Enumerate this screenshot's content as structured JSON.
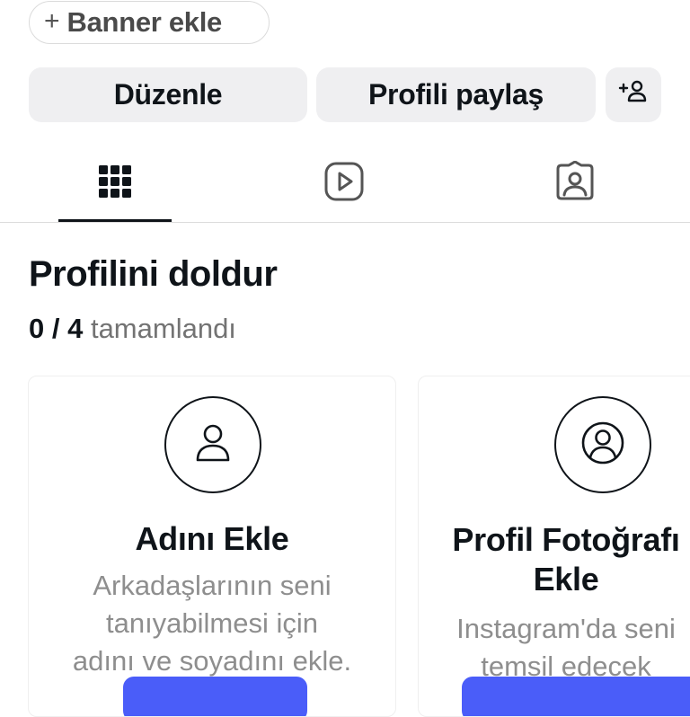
{
  "banner": {
    "plus": "+",
    "label": "Banner ekle"
  },
  "actions": {
    "edit_label": "Düzenle",
    "share_label": "Profili paylaş"
  },
  "tabs": [
    {
      "icon": "grid-icon",
      "active": true
    },
    {
      "icon": "reels-play-icon",
      "active": false
    },
    {
      "icon": "tagged-portrait-icon",
      "active": false
    }
  ],
  "profile_completion": {
    "title": "Profilini doldur",
    "count": "0 / 4",
    "status": "tamamlandı"
  },
  "cards": [
    {
      "icon": "user-icon",
      "title": "Adını Ekle",
      "description_lines": [
        "Arkadaşlarının seni",
        "tanıyabilmesi için",
        "adını ve soyadını ekle."
      ]
    },
    {
      "icon": "profile-photo-icon",
      "title_lines": [
        "Profil Fotoğrafı",
        "Ekle"
      ],
      "description_lines": [
        "Instagram'da seni",
        "temsil edecek"
      ]
    }
  ],
  "colors": {
    "accent": "#4a5df9",
    "button_bg": "#efeff1",
    "muted_text": "#8e8e8e"
  }
}
